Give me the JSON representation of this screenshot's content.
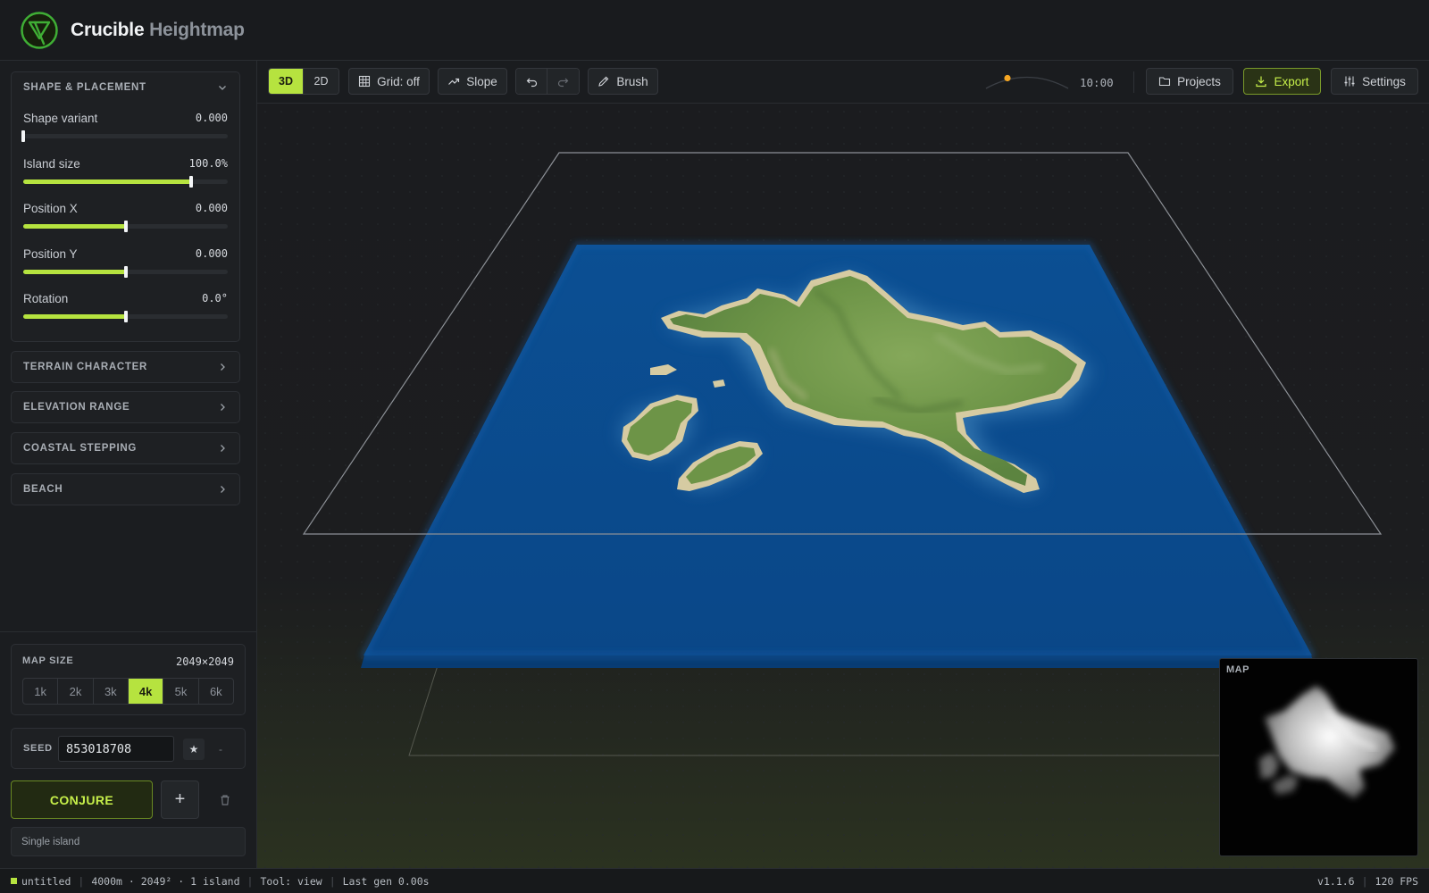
{
  "app": {
    "title_primary": "Crucible",
    "title_secondary": "Heightmap"
  },
  "sidebar": {
    "shape_panel": {
      "title": "SHAPE & PLACEMENT",
      "sliders": [
        {
          "label": "Shape variant",
          "value": "0.000",
          "fraction": 0.0
        },
        {
          "label": "Island size",
          "value": "100.0%",
          "fraction": 0.82
        },
        {
          "label": "Position X",
          "value": "0.000",
          "fraction": 0.5
        },
        {
          "label": "Position Y",
          "value": "0.000",
          "fraction": 0.5
        },
        {
          "label": "Rotation",
          "value": "0.0°",
          "fraction": 0.5
        }
      ]
    },
    "collapsed_panels": [
      "TERRAIN CHARACTER",
      "ELEVATION RANGE",
      "COASTAL STEPPING",
      "BEACH"
    ],
    "map_size": {
      "label": "MAP SIZE",
      "value": "2049×2049",
      "options": [
        "1k",
        "2k",
        "3k",
        "4k",
        "5k",
        "6k"
      ],
      "selected": "4k"
    },
    "seed": {
      "label": "SEED",
      "value": "853018708",
      "star_icon": "★",
      "dash_icon": "-"
    },
    "actions": {
      "conjure_label": "CONJURE",
      "add_label": "+"
    },
    "mode_text": "Single island"
  },
  "toolbar": {
    "view_modes": [
      "3D",
      "2D"
    ],
    "active_view": "3D",
    "grid_label": "Grid: off",
    "slope_label": "Slope",
    "brush_label": "Brush",
    "time": "10:00",
    "projects_label": "Projects",
    "export_label": "Export",
    "settings_label": "Settings"
  },
  "minimap": {
    "label": "MAP"
  },
  "status": {
    "file": "untitled",
    "dims": "4000m · 2049² · 1 island",
    "tool": "Tool: view",
    "last_gen": "Last gen 0.00s",
    "version": "v1.1.6",
    "fps": "120 FPS"
  },
  "colors": {
    "accent": "#b6e33f",
    "water": "#0a4c8e",
    "land": "#6f9a4a",
    "sand": "#d4c9a0"
  }
}
